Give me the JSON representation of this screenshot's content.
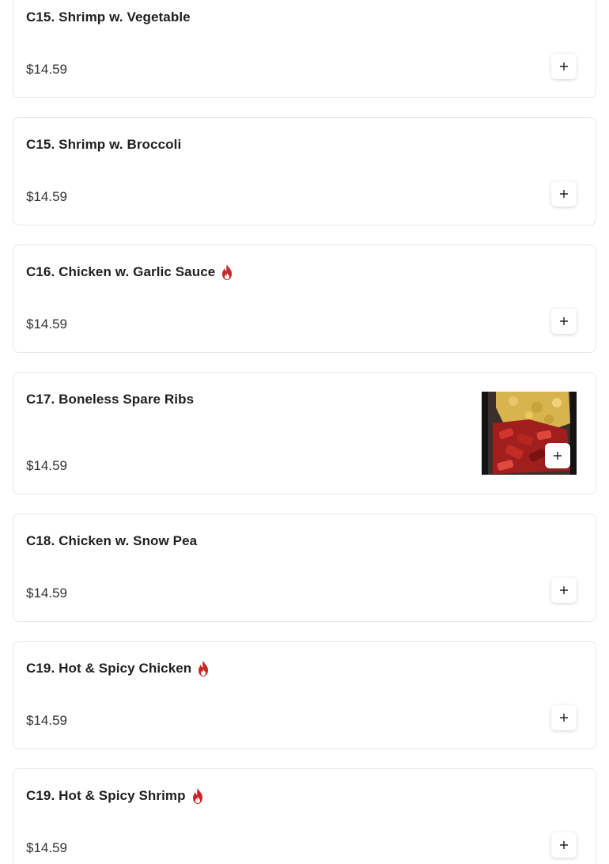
{
  "colors": {
    "spicy": "#c62828",
    "card_border": "#e8e8e8",
    "text": "#1f1f1f"
  },
  "icons": {
    "spicy": "flame-icon",
    "add": "plus-icon"
  },
  "menu_items": [
    {
      "name": "C15. Shrimp w. Vegetable",
      "price": "$14.59",
      "spicy": false,
      "image": false
    },
    {
      "name": "C15. Shrimp w. Broccoli",
      "price": "$14.59",
      "spicy": false,
      "image": false
    },
    {
      "name": "C16. Chicken w. Garlic Sauce",
      "price": "$14.59",
      "spicy": true,
      "image": false
    },
    {
      "name": "C17. Boneless Spare Ribs",
      "price": "$14.59",
      "spicy": false,
      "image": true
    },
    {
      "name": "C18. Chicken w. Snow Pea",
      "price": "$14.59",
      "spicy": false,
      "image": false
    },
    {
      "name": "C19. Hot & Spicy Chicken",
      "price": "$14.59",
      "spicy": true,
      "image": false
    },
    {
      "name": "C19. Hot & Spicy Shrimp",
      "price": "$14.59",
      "spicy": true,
      "image": false
    }
  ]
}
